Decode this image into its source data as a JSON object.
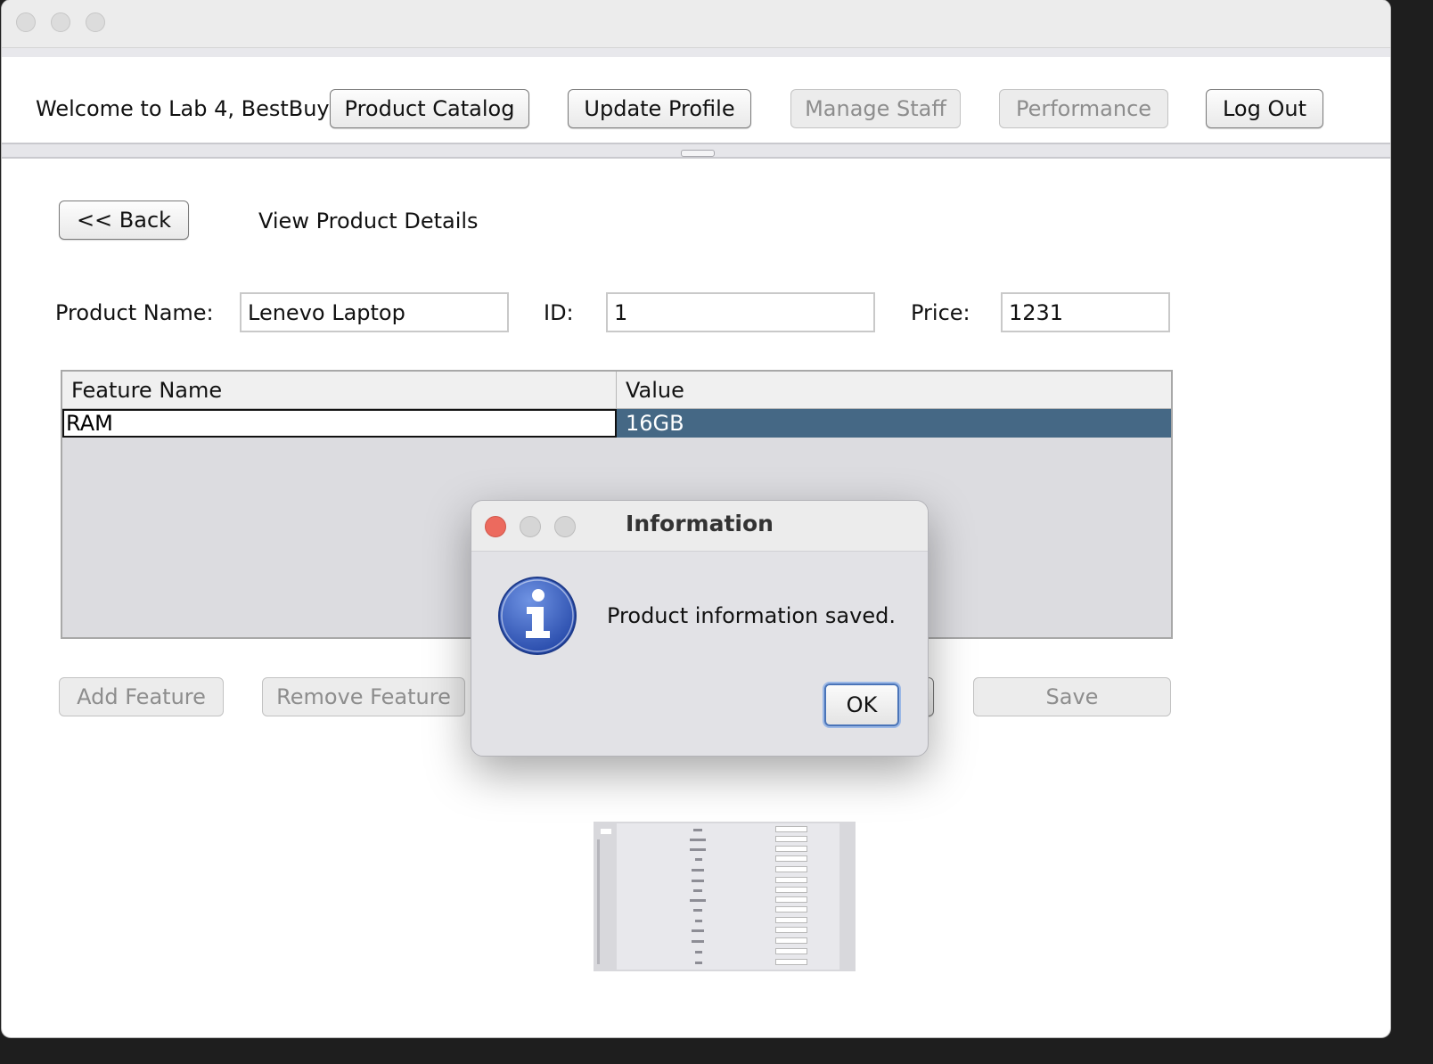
{
  "topbar": {
    "welcome": "Welcome to Lab 4, BestBuy",
    "buttons": {
      "product_catalog": "Product Catalog",
      "update_profile": "Update Profile",
      "manage_staff": "Manage Staff",
      "performance": "Performance",
      "log_out": "Log Out"
    }
  },
  "view": {
    "back_label": "<< Back",
    "title": "View Product Details"
  },
  "form": {
    "product_name_label": "Product Name:",
    "product_name_value": "Lenevo Laptop",
    "id_label": "ID:",
    "id_value": "1",
    "price_label": "Price:",
    "price_value": "1231"
  },
  "features_table": {
    "columns": [
      "Feature Name",
      "Value"
    ],
    "rows": [
      {
        "feature": "RAM",
        "value": "16GB"
      }
    ],
    "selected_color": "#456885"
  },
  "actions": {
    "add_feature": "Add Feature",
    "remove_feature": "Remove Feature",
    "save": "Save"
  },
  "dialog": {
    "title": "Information",
    "message": "Product information saved.",
    "ok_label": "OK",
    "icon": "info-icon"
  }
}
